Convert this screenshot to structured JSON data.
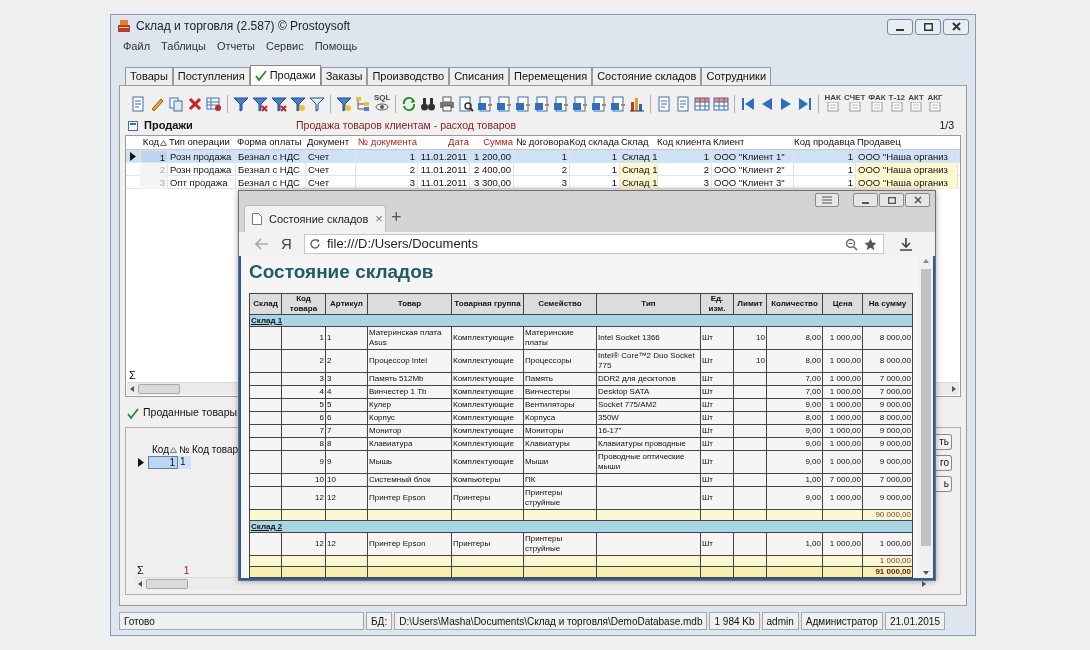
{
  "window": {
    "title": "Склад и торговля (2.587) © Prostoysoft"
  },
  "menu": [
    "Файл",
    "Таблицы",
    "Отчеты",
    "Сервис",
    "Помощь"
  ],
  "tabs": [
    {
      "label": "Товары",
      "selected": false
    },
    {
      "label": "Поступления",
      "selected": false
    },
    {
      "label": "Продажи",
      "selected": true
    },
    {
      "label": "Заказы",
      "selected": false
    },
    {
      "label": "Производство",
      "selected": false
    },
    {
      "label": "Списания",
      "selected": false
    },
    {
      "label": "Перемещения",
      "selected": false
    },
    {
      "label": "Состояние складов",
      "selected": false
    },
    {
      "label": "Сотрудники",
      "selected": false
    }
  ],
  "toolbar": [
    {
      "kind": "document"
    },
    {
      "kind": "edit"
    },
    {
      "kind": "copy"
    },
    {
      "kind": "delete"
    },
    {
      "kind": "table_delete"
    },
    {
      "kind": "separator"
    },
    {
      "kind": "filter"
    },
    {
      "kind": "filter_off"
    },
    {
      "kind": "filter_off"
    },
    {
      "kind": "filter_edit"
    },
    {
      "kind": "filter_user"
    },
    {
      "kind": "separator"
    },
    {
      "kind": "filter_edit"
    },
    {
      "kind": "tree"
    },
    {
      "kind": "sql",
      "label": "SQL"
    },
    {
      "kind": "separator"
    },
    {
      "kind": "refresh"
    },
    {
      "kind": "find"
    },
    {
      "kind": "print"
    },
    {
      "kind": "preview"
    },
    {
      "kind": "export"
    },
    {
      "kind": "export"
    },
    {
      "kind": "export"
    },
    {
      "kind": "export"
    },
    {
      "kind": "export"
    },
    {
      "kind": "export"
    },
    {
      "kind": "export"
    },
    {
      "kind": "export"
    },
    {
      "kind": "chart"
    },
    {
      "kind": "separator"
    },
    {
      "kind": "document"
    },
    {
      "kind": "document"
    },
    {
      "kind": "table"
    },
    {
      "kind": "table"
    },
    {
      "kind": "separator"
    },
    {
      "kind": "first"
    },
    {
      "kind": "prev"
    },
    {
      "kind": "next"
    },
    {
      "kind": "last"
    },
    {
      "kind": "separator"
    },
    {
      "kind": "form",
      "label": "НАК"
    },
    {
      "kind": "form",
      "label": "СЧЕТ"
    },
    {
      "kind": "form",
      "label": "ФАК"
    },
    {
      "kind": "form",
      "label": "Т-12"
    },
    {
      "kind": "form",
      "label": "АКТ"
    },
    {
      "kind": "form",
      "label": "АКГ"
    }
  ],
  "panel": {
    "title": "Продажи",
    "subtitle": "Продажа товаров клиентам - расход товаров",
    "page": "1/3"
  },
  "grid": {
    "columns": [
      {
        "label": "Код",
        "sorted": true,
        "highlight": false,
        "tinted": false
      },
      {
        "label": "Тип операции",
        "sorted": false,
        "highlight": false,
        "tinted": false
      },
      {
        "label": "Форма оплаты",
        "sorted": false,
        "highlight": false,
        "tinted": false
      },
      {
        "label": "Документ",
        "sorted": false,
        "highlight": false,
        "tinted": false
      },
      {
        "label": "№ документа",
        "sorted": false,
        "highlight": true,
        "tinted": false
      },
      {
        "label": "Дата",
        "sorted": false,
        "highlight": true,
        "tinted": false
      },
      {
        "label": "Сумма",
        "sorted": false,
        "highlight": true,
        "tinted": false
      },
      {
        "label": "№ договора",
        "sorted": false,
        "highlight": false,
        "tinted": false
      },
      {
        "label": "Код склада",
        "sorted": false,
        "highlight": false,
        "tinted": false
      },
      {
        "label": "Склад",
        "sorted": false,
        "highlight": false,
        "tinted": true
      },
      {
        "label": "Код клиента",
        "sorted": false,
        "highlight": false,
        "tinted": false
      },
      {
        "label": "Клиент",
        "sorted": false,
        "highlight": false,
        "tinted": false
      },
      {
        "label": "Код продавца",
        "sorted": false,
        "highlight": false,
        "tinted": false
      },
      {
        "label": "Продавец",
        "sorted": false,
        "highlight": false,
        "tinted": true
      }
    ],
    "rows": [
      {
        "selected": true,
        "cells": [
          "1",
          "Розн продажа",
          "Безнал с НДС",
          "Счет",
          "1",
          "11.01.2011",
          "1 200,00",
          "1",
          "1",
          "Склад 1",
          "1",
          "ООО \"Клиент 1\"",
          "1",
          "ООО \"Наша организ"
        ]
      },
      {
        "selected": false,
        "cells": [
          "2",
          "Розн продажа",
          "Безнал с НДС",
          "Счет",
          "2",
          "11.01.2011",
          "2 400,00",
          "2",
          "1",
          "Склад 1",
          "2",
          "ООО \"Клиент 2\"",
          "1",
          "ООО \"Наша организ"
        ]
      },
      {
        "selected": false,
        "cells": [
          "3",
          "Опт продажа",
          "Безнал с НДС",
          "Счет",
          "3",
          "11.01.2011",
          "3 300,00",
          "3",
          "1",
          "Склад 1",
          "3",
          "ООО \"Клиент 3\"",
          "1",
          "ООО \"Наша организ"
        ]
      }
    ],
    "sum_sign": "Σ"
  },
  "detail": {
    "title": "Проданные товары",
    "columns": [
      {
        "label": "Код",
        "sorted": true
      },
      {
        "label": "№",
        "sorted": false
      },
      {
        "label": "Код товар",
        "sorted": false
      }
    ],
    "rows": [
      {
        "selected": true,
        "cells": [
          "1",
          "1"
        ]
      }
    ],
    "sum_sign": "Σ",
    "sum": "1"
  },
  "side_buttons": [
    "ть",
    "го",
    "ь"
  ],
  "status_bar": {
    "state": "Готово",
    "db_label": "БД:",
    "db_path": "D:\\Users\\Masha\\Documents\\Склад и торговля\\DemoDatabase.mdb",
    "size": "1 984 Kb",
    "user": "admin",
    "role": "Администратор",
    "date": "21.01.2015"
  },
  "browser": {
    "tab": {
      "title": "Состояние складов",
      "close": "×"
    },
    "new_tab": "+",
    "logo": "Я",
    "url": "file:///D:/Users/Documents",
    "page": {
      "heading": "Состояние складов",
      "columns": [
        "Склад",
        "Код товара",
        "Артикул",
        "Товар",
        "Товарная группа",
        "Семейство",
        "Тип",
        "Ед. изм.",
        "Лимит",
        "Количество",
        "Цена",
        "На сумму"
      ],
      "rows": [
        {
          "kind": "group",
          "label": "Склад 1"
        },
        {
          "kind": "item",
          "code": "1",
          "article": "1",
          "product": "Материнская плата Asus",
          "group": "Комплектующие",
          "family": "Материнские платы",
          "type": "Intel Socket 1366",
          "unit": "Шт",
          "limit": "10",
          "quantity": "8,00",
          "price": "1 000,00",
          "amount": "8 000,00"
        },
        {
          "kind": "item",
          "code": "2",
          "article": "2",
          "product": "Процессор Intel",
          "group": "Комплектующие",
          "family": "Процессоры",
          "type": "Intel® Core™2 Duo Socket 775",
          "unit": "Шт",
          "limit": "10",
          "quantity": "8,00",
          "price": "1 000,00",
          "amount": "8 000,00"
        },
        {
          "kind": "item",
          "code": "3",
          "article": "3",
          "product": "Память 512Mb",
          "group": "Комплектующие",
          "family": "Память",
          "type": "DDR2 для десктопов",
          "unit": "Шт",
          "quantity": "7,00",
          "price": "1 000,00",
          "amount": "7 000,00"
        },
        {
          "kind": "item",
          "code": "4",
          "article": "4",
          "product": "Винчестер 1 Tb",
          "group": "Комплектующие",
          "family": "Винчестеры",
          "type": "Desktop SATA",
          "unit": "Шт",
          "quantity": "7,00",
          "price": "1 000,00",
          "amount": "7 000,00"
        },
        {
          "kind": "item",
          "code": "5",
          "article": "5",
          "product": "Кулер",
          "group": "Комплектующие",
          "family": "Вентиляторы",
          "type": "Socket 775/AM2",
          "unit": "Шт",
          "quantity": "9,00",
          "price": "1 000,00",
          "amount": "9 000,00"
        },
        {
          "kind": "item",
          "code": "6",
          "article": "6",
          "product": "Корпус",
          "group": "Комплектующие",
          "family": "Корпуса",
          "type": "350W",
          "unit": "Шт",
          "quantity": "8,00",
          "price": "1 000,00",
          "amount": "8 000,00"
        },
        {
          "kind": "item",
          "code": "7",
          "article": "7",
          "product": "Монитор",
          "group": "Комплектующие",
          "family": "Мониторы",
          "type": "16-17\"",
          "unit": "Шт",
          "quantity": "9,00",
          "price": "1 000,00",
          "amount": "9 000,00"
        },
        {
          "kind": "item",
          "code": "8",
          "article": "8",
          "product": "Клавиатура",
          "group": "Комплектующие",
          "family": "Клавиатуры",
          "type": "Клавиатуры проводные",
          "unit": "Шт",
          "quantity": "9,00",
          "price": "1 000,00",
          "amount": "9 000,00"
        },
        {
          "kind": "item",
          "code": "9",
          "article": "9",
          "product": "Мышь",
          "group": "Комплектующие",
          "family": "Мыши",
          "type": "Проводные оптические мыши",
          "unit": "Шт",
          "quantity": "9,00",
          "price": "1 000,00",
          "amount": "9 000,00"
        },
        {
          "kind": "item",
          "code": "10",
          "article": "10",
          "product": "Системный блок",
          "group": "Компьютеры",
          "family": "ПК",
          "unit": "Шт",
          "quantity": "1,00",
          "price": "7 000,00",
          "amount": "7 000,00"
        },
        {
          "kind": "item",
          "code": "12",
          "article": "12",
          "product": "Принтер Epson",
          "group": "Принтеры",
          "family": "Принтеры струйные",
          "unit": "Шт",
          "quantity": "9,00",
          "price": "1 000,00",
          "amount": "9 000,00"
        },
        {
          "kind": "subtotal",
          "amount": "90 000,00"
        },
        {
          "kind": "group",
          "label": "Склад 2"
        },
        {
          "kind": "item",
          "code": "12",
          "article": "12",
          "product": "Принтер Epson",
          "group": "Принтеры",
          "family": "Принтеры струйные",
          "unit": "Шт",
          "quantity": "1,00",
          "price": "1 000,00",
          "amount": "1 000,00"
        },
        {
          "kind": "subtotal",
          "amount": "1 000,00"
        },
        {
          "kind": "total",
          "amount": "91 000,00"
        }
      ]
    }
  }
}
